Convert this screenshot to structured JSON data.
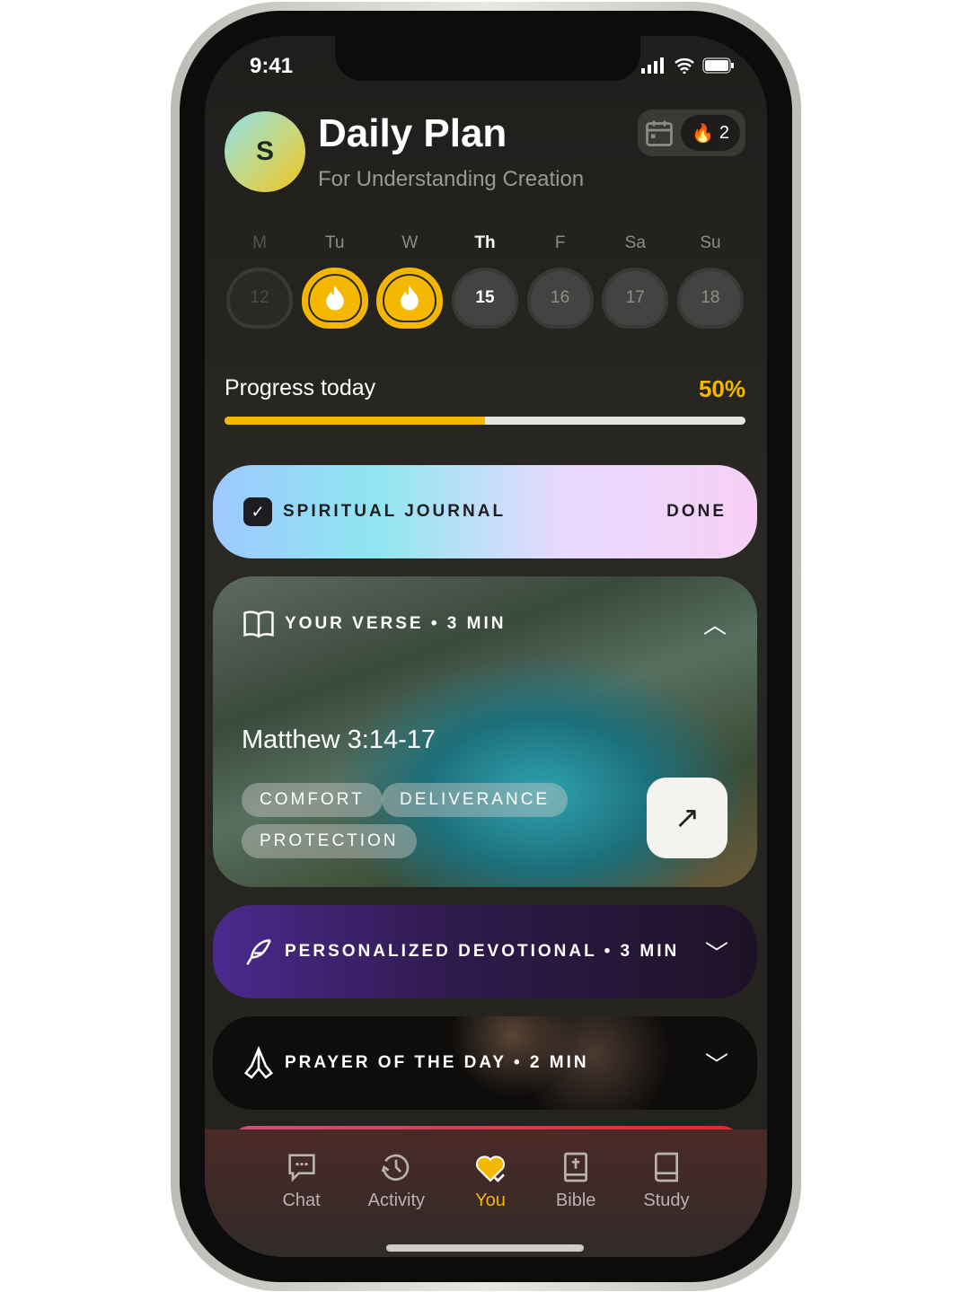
{
  "status": {
    "time": "9:41"
  },
  "header": {
    "avatar_initial": "S",
    "title": "Daily Plan",
    "subtitle": "For Understanding Creation",
    "streak_count": "2"
  },
  "week": [
    {
      "label": "M",
      "date": "12",
      "state": "past"
    },
    {
      "label": "Tu",
      "date": "",
      "state": "done"
    },
    {
      "label": "W",
      "date": "",
      "state": "done"
    },
    {
      "label": "Th",
      "date": "15",
      "state": "today"
    },
    {
      "label": "F",
      "date": "16",
      "state": "future"
    },
    {
      "label": "Sa",
      "date": "17",
      "state": "future"
    },
    {
      "label": "Su",
      "date": "18",
      "state": "future"
    }
  ],
  "progress": {
    "label": "Progress today",
    "value_text": "50%",
    "value": 50
  },
  "journal": {
    "title": "SPIRITUAL JOURNAL",
    "status": "DONE"
  },
  "verse": {
    "title": "YOUR VERSE • 3 MIN",
    "reference": "Matthew 3:14-17",
    "tags": [
      "COMFORT",
      "DELIVERANCE",
      "PROTECTION"
    ]
  },
  "devotional": {
    "title": "PERSONALIZED DEVOTIONAL • 3 MIN"
  },
  "prayer": {
    "title": "PRAYER OF THE DAY • 2 MIN"
  },
  "nav": [
    {
      "label": "Chat",
      "icon": "chat-icon"
    },
    {
      "label": "Activity",
      "icon": "history-icon"
    },
    {
      "label": "You",
      "icon": "heart-icon",
      "active": true
    },
    {
      "label": "Bible",
      "icon": "bible-icon"
    },
    {
      "label": "Study",
      "icon": "book-icon"
    }
  ],
  "colors": {
    "accent": "#f5b800"
  }
}
